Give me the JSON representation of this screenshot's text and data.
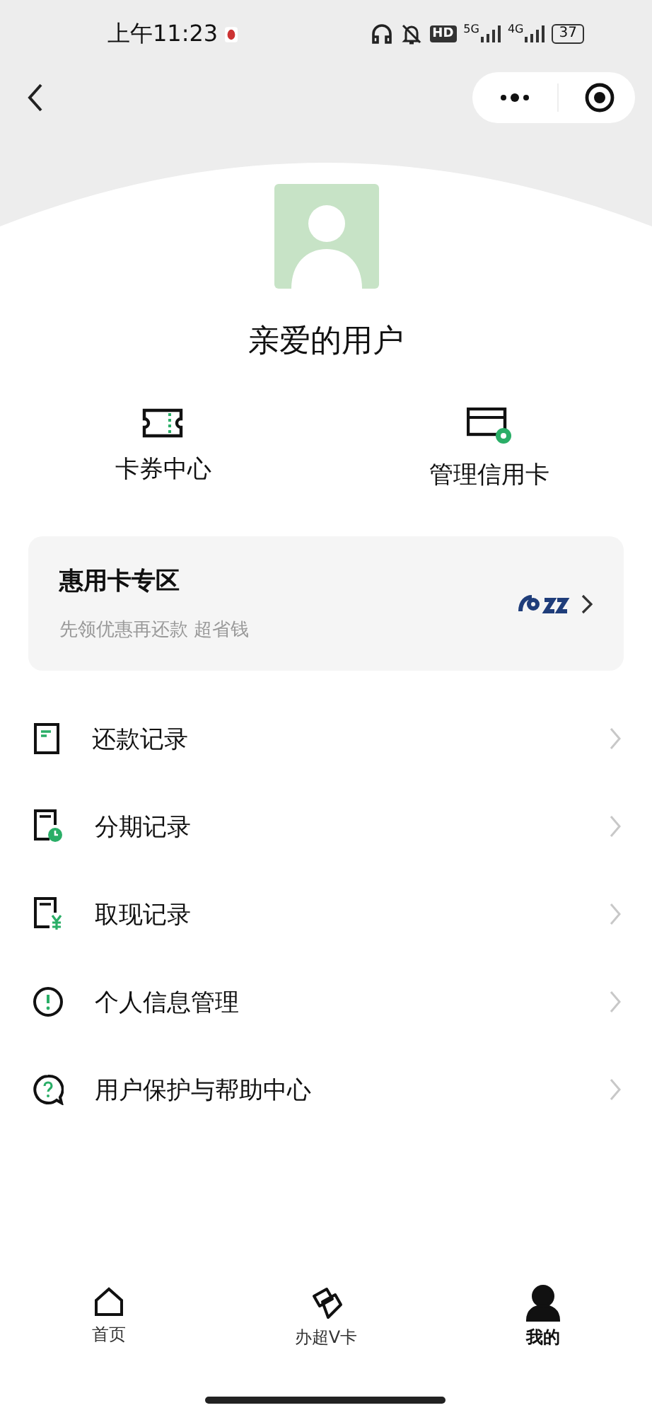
{
  "status_bar": {
    "time": "上午11:23",
    "hd": "HD",
    "net_1": "5G",
    "net_2": "4G",
    "battery": "37"
  },
  "profile": {
    "name": "亲爱的用户"
  },
  "quick_actions": [
    {
      "label": "卡券中心"
    },
    {
      "label": "管理信用卡"
    }
  ],
  "promo_card": {
    "title": "惠用卡专区",
    "subtitle": "先领优惠再还款 超省钱"
  },
  "menu": [
    {
      "label": "还款记录"
    },
    {
      "label": "分期记录"
    },
    {
      "label": "取现记录"
    },
    {
      "label": "个人信息管理"
    },
    {
      "label": "用户保护与帮助中心"
    }
  ],
  "tab_bar": [
    {
      "label": "首页",
      "selected": false
    },
    {
      "label": "办超V卡",
      "selected": false
    },
    {
      "label": "我的",
      "selected": true
    }
  ]
}
